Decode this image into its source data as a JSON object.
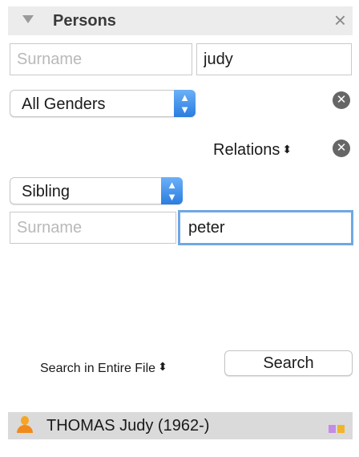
{
  "panel": {
    "title": "Persons",
    "close_icon": "×"
  },
  "name_filter": {
    "surname_placeholder": "Surname",
    "given_value": "judy"
  },
  "gender": {
    "selected": "All Genders"
  },
  "relations": {
    "label": "Relations"
  },
  "relation": {
    "selected": "Sibling",
    "surname_placeholder": "Surname",
    "given_value": "peter"
  },
  "scope": {
    "label": "Search in Entire File"
  },
  "search_button": {
    "label": "Search"
  },
  "results": [
    {
      "name": "THOMAS Judy (1962-)"
    }
  ],
  "colors": {
    "accent": "#2a7de0",
    "focus": "#6fa7e6",
    "person_icon": "#f5a623",
    "bar_purple": "#c58be6",
    "bar_yellow": "#f1b52b"
  }
}
